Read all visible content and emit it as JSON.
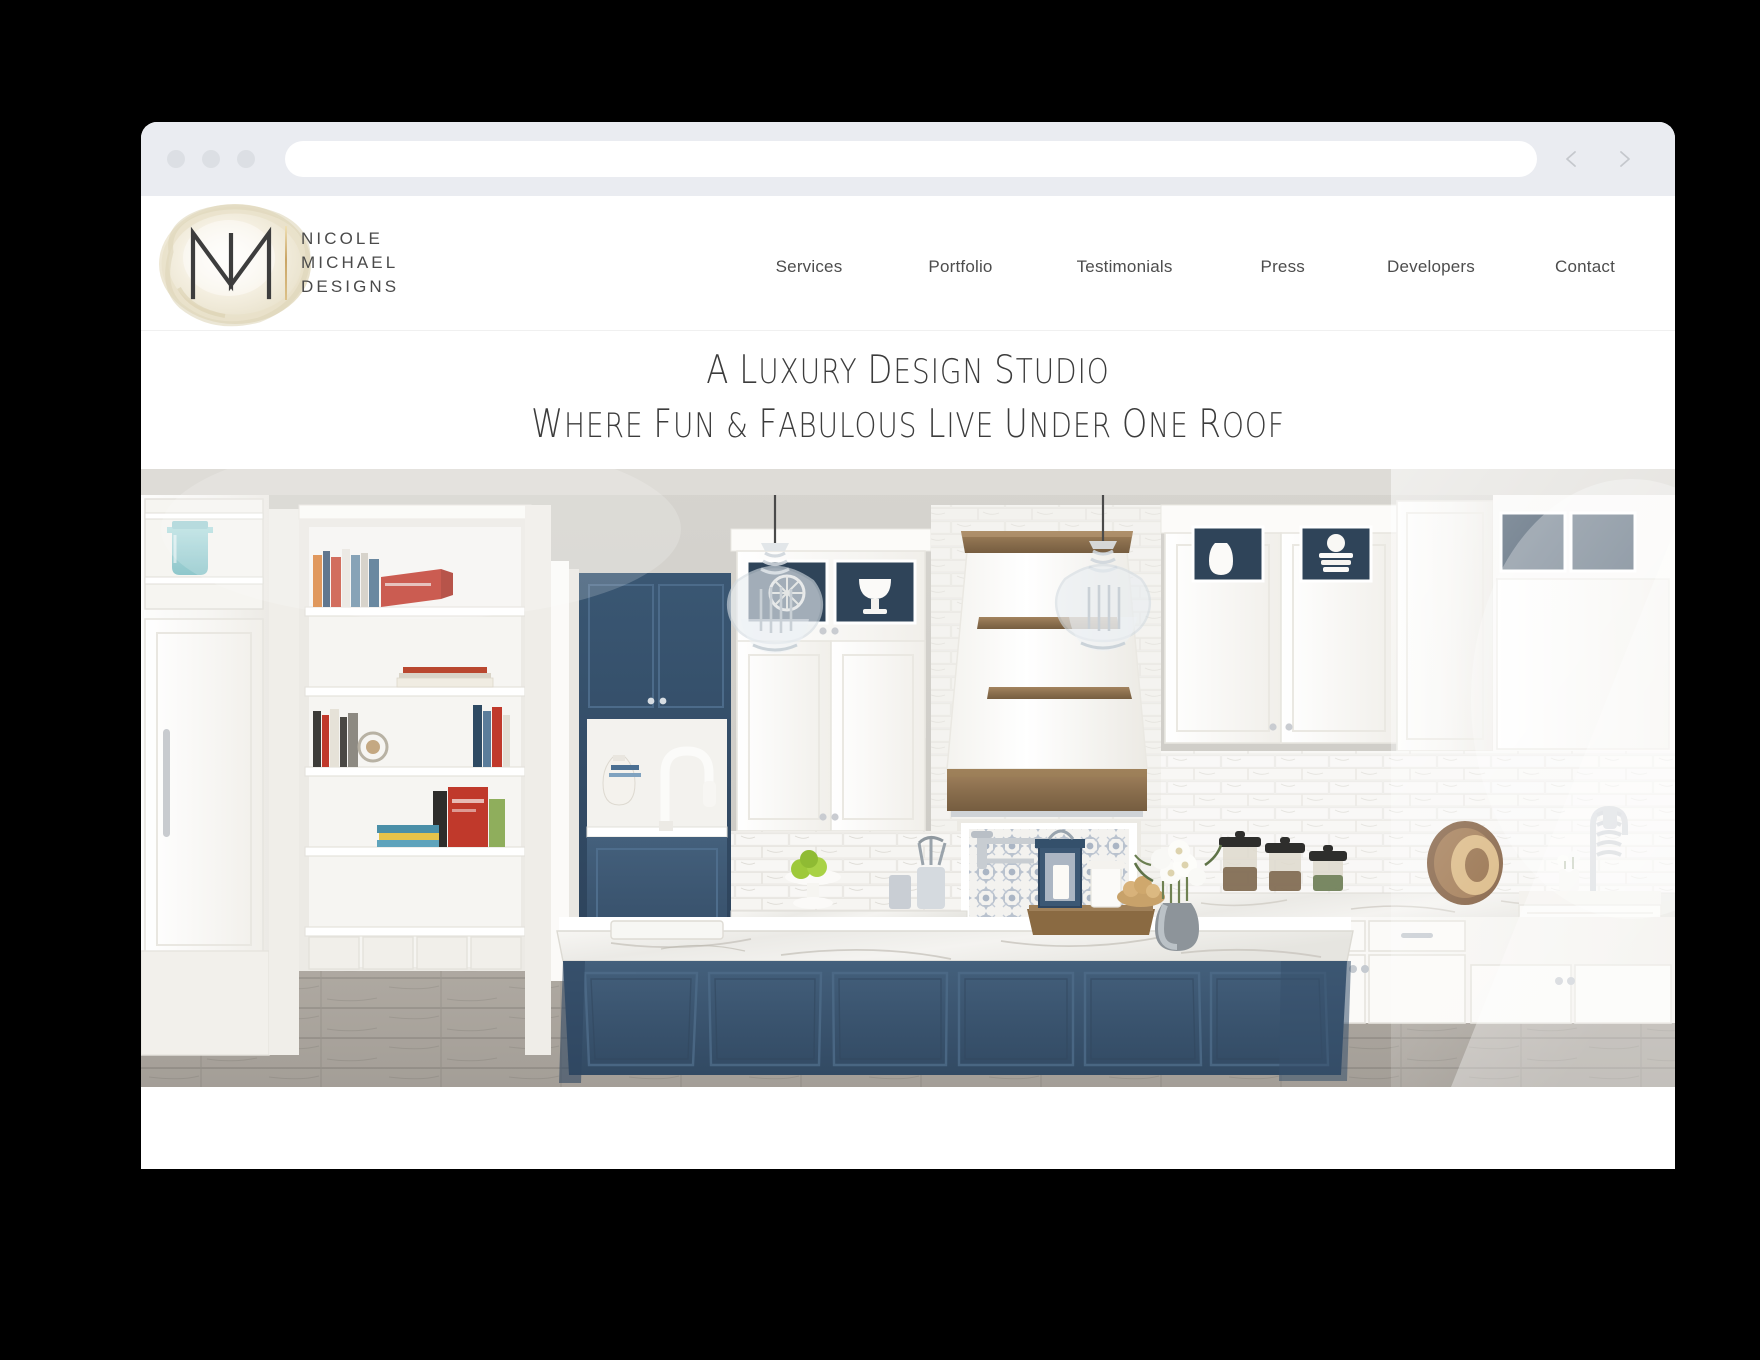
{
  "browser": {
    "url_value": "",
    "url_placeholder": "",
    "dots": [
      "window-dot-red",
      "window-dot-yellow",
      "window-dot-green"
    ],
    "back_label": "Back",
    "forward_label": "Forward"
  },
  "site": {
    "brand": {
      "monogram": "NM",
      "wordmark_line1": "NICOLE",
      "wordmark_line2": "MICHAEL",
      "wordmark_line3": "DESIGNS",
      "accent_gold": "#c9a464",
      "brushstroke_cream": "#efe9d8"
    },
    "nav": {
      "items": [
        {
          "label": "Services"
        },
        {
          "label": "Portfolio"
        },
        {
          "label": "Testimonials"
        },
        {
          "label": "Press"
        },
        {
          "label": "Developers"
        },
        {
          "label": "Contact"
        }
      ]
    },
    "tagline": {
      "line1": "A Luxury Design Studio",
      "line2": "Where Fun & Fabulous Live Under One Roof"
    },
    "hero": {
      "alt": "Luxury white kitchen with navy blue island, marble countertops, glass pendant lights and white wood range hood",
      "colors": {
        "island_navy": "#3b5570",
        "cabinet_white": "#fbfbfa",
        "wall_gray": "#cfcdc8",
        "marble_light": "#f2f1ee",
        "wood_hood": "#8b6f4e",
        "floor_gray": "#9d9994",
        "glass_teal": "#9ccfd3",
        "book_red": "#c0392b",
        "apple_green": "#9ec93a"
      }
    }
  }
}
